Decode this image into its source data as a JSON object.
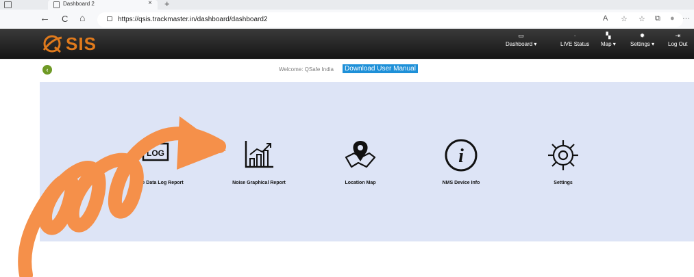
{
  "browser": {
    "tab_title": "Dashboard 2",
    "tab_close": "×",
    "new_tab": "+",
    "back": "←",
    "refresh": "C",
    "home": "⌂",
    "url": "https://qsis.trackmaster.in/dashboard/dashboard2",
    "toolbar_icons": [
      "A",
      "☆",
      "☆",
      "⧉",
      "●",
      "···"
    ]
  },
  "header": {
    "logo_text": "SIS",
    "nav": [
      {
        "label": "Dashboard ▾",
        "icon": "monitor-icon",
        "glyph": "▭"
      },
      {
        "label": "LIVE Status",
        "icon": "signal-icon",
        "glyph": "·"
      },
      {
        "label": "Map ▾",
        "icon": "map-icon",
        "glyph": "▚"
      },
      {
        "label": "Settings ▾",
        "icon": "gear-icon",
        "glyph": "✹"
      },
      {
        "label": "Log Out",
        "icon": "logout-icon",
        "glyph": "⇥"
      }
    ]
  },
  "welcome": {
    "back_glyph": "‹",
    "text": "Welcome: QSafe India",
    "manual_link": "Download User Manual"
  },
  "tiles": [
    {
      "label": "Noise Data Log Report",
      "icon": "log-icon",
      "icon_text": "LOG"
    },
    {
      "label": "Noise Graphical Report",
      "icon": "bar-chart-icon"
    },
    {
      "label": "Location Map",
      "icon": "location-map-icon"
    },
    {
      "label": "NMS Device Info",
      "icon": "info-icon",
      "icon_text": "i"
    },
    {
      "label": "Settings",
      "icon": "gear-icon"
    }
  ],
  "colors": {
    "accent_orange": "#f5904a",
    "panel": "#dde4f6",
    "header": "#1c1c1c",
    "manual_link": "#1e90d8",
    "back_button": "#6f9a26"
  }
}
